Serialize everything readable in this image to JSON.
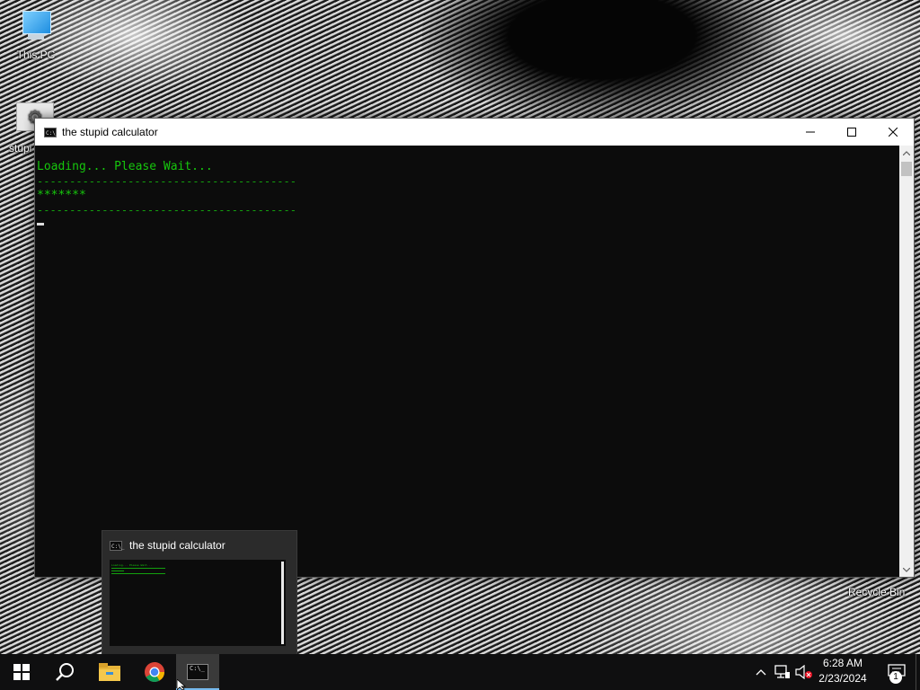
{
  "desktop": {
    "icons": [
      {
        "label": "This PC"
      },
      {
        "label": "stupi"
      }
    ],
    "recycle_bin_label": "Recycle Bin"
  },
  "window": {
    "title": "the stupid calculator",
    "controls": {
      "minimize": "minimize-icon",
      "maximize": "maximize-icon",
      "close": "close-icon"
    },
    "console_lines": [
      "Loading... Please Wait...",
      "----------------------------------------",
      "*******",
      "----------------------------------------"
    ],
    "text_color": "#16c60c",
    "background": "#0c0c0c"
  },
  "preview": {
    "title": "the stupid calculator",
    "thumb_text": "Loading... Please Wait..."
  },
  "taskbar": {
    "apps": [
      "start",
      "search",
      "file-explorer",
      "chrome",
      "console"
    ],
    "clock_time": "6:28 AM",
    "clock_date": "2/23/2024",
    "notification_count": "1",
    "accent": "#76b9ed"
  }
}
